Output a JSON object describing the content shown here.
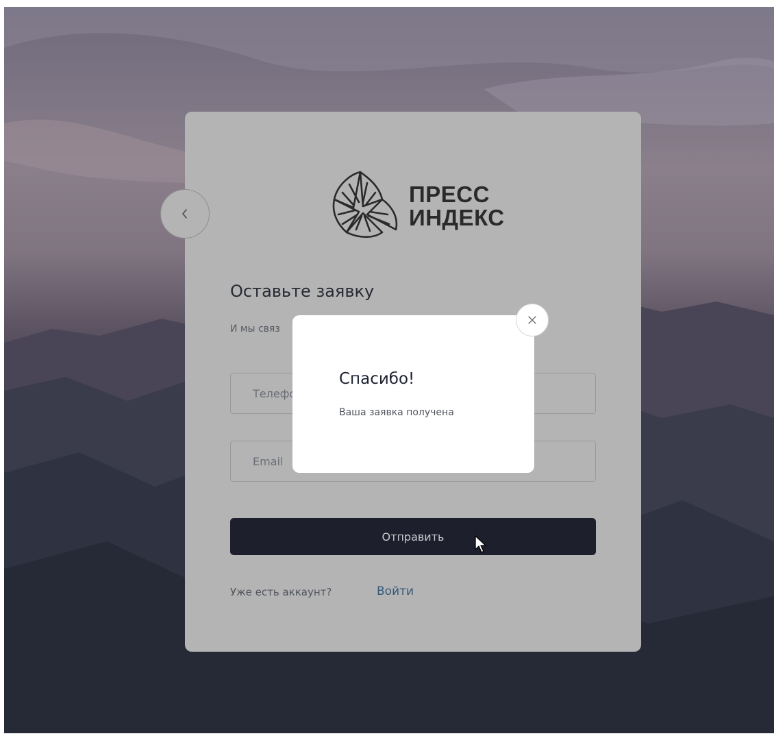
{
  "brand": {
    "line1": "ПРЕСС",
    "line2": "ИНДЕКС"
  },
  "form": {
    "title": "Оставьте заявку",
    "subtitle": "И мы связ",
    "phone_placeholder": "Телефон",
    "email_placeholder": "Email",
    "submit_label": "Отправить",
    "have_account": "Уже есть аккаунт?",
    "login_link": "Войти"
  },
  "modal": {
    "title": "Спасибо!",
    "text": "Ваша заявка получена"
  },
  "colors": {
    "card": "#b4b4b4",
    "button": "#1d1f2c",
    "link": "#35597a",
    "modal": "#ffffff"
  },
  "icons": {
    "back": "chevron-left-icon",
    "close": "close-icon",
    "cursor": "mouse-pointer-icon"
  }
}
